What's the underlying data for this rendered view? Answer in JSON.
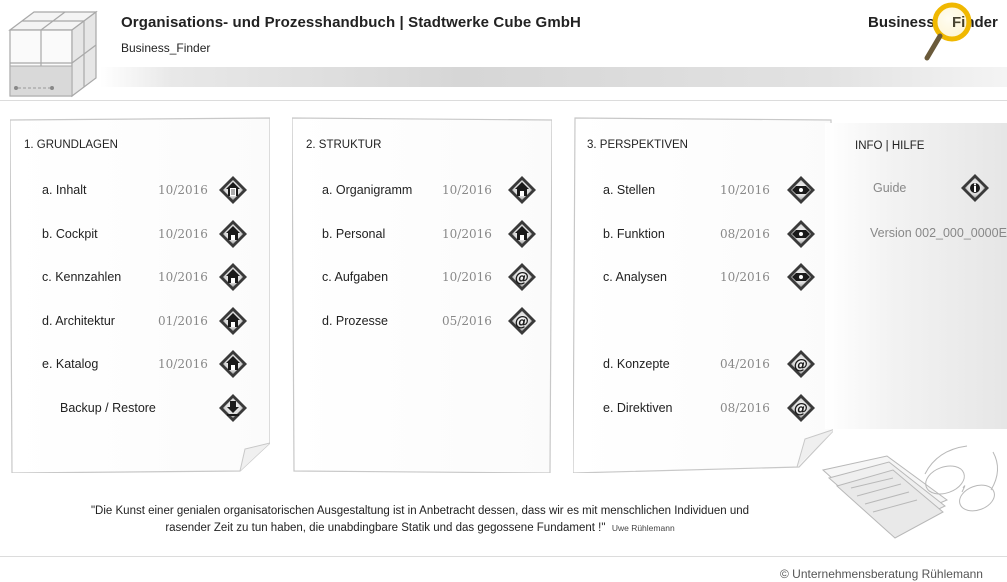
{
  "header": {
    "title": "Organisations- und Prozesshandbuch | Stadtwerke Cube GmbH",
    "subtitle": "Business_Finder",
    "brand_left": "Business",
    "brand_right": "Finder"
  },
  "panels": [
    {
      "title": "1.  GRUNDLAGEN",
      "items": [
        {
          "label": "a.  Inhalt",
          "date": "10/2016",
          "icon": "house-page-icon"
        },
        {
          "label": "b.  Cockpit",
          "date": "10/2016",
          "icon": "house-icon"
        },
        {
          "label": "c.  Kennzahlen",
          "date": "10/2016",
          "icon": "house-icon"
        },
        {
          "label": "d.  Architektur",
          "date": "01/2016",
          "icon": "house-icon"
        },
        {
          "label": "e.  Katalog",
          "date": "10/2016",
          "icon": "house-icon"
        },
        {
          "label": "Backup / Restore",
          "date": "",
          "icon": "download-icon"
        }
      ]
    },
    {
      "title": "2.  STRUKTUR",
      "items": [
        {
          "label": "a.  Organigramm",
          "date": "10/2016",
          "icon": "house-icon"
        },
        {
          "label": "b.  Personal",
          "date": "10/2016",
          "icon": "house-icon"
        },
        {
          "label": "c.  Aufgaben",
          "date": "10/2016",
          "icon": "at-icon"
        },
        {
          "label": "d.  Prozesse",
          "date": "05/2016",
          "icon": "at-icon"
        }
      ]
    },
    {
      "title": "3.  PERSPEKTIVEN",
      "items": [
        {
          "label": "a.  Stellen",
          "date": "10/2016",
          "icon": "arrows-icon"
        },
        {
          "label": "b.  Funktion",
          "date": "08/2016",
          "icon": "arrows-icon"
        },
        {
          "label": "c.  Analysen",
          "date": "10/2016",
          "icon": "arrows-icon"
        },
        {
          "label": "d.  Konzepte",
          "date": "04/2016",
          "icon": "at-icon"
        },
        {
          "label": "e.  Direktiven",
          "date": "08/2016",
          "icon": "at-icon"
        }
      ]
    }
  ],
  "info": {
    "title": "INFO | HILFE",
    "guide": "Guide",
    "version": "Version  002_000_0000E"
  },
  "quote": {
    "line1": "\"Die Kunst einer genialen organisatorischen Ausgestaltung ist in Anbetracht dessen, dass wir es mit menschlichen Individuen und",
    "line2": "rasender  Zeit  zu tun haben, die unabdingbare Statik und das gegossene Fundament !\"",
    "author": "Uwe Rühlemann"
  },
  "footer": {
    "copyright": "© Unternehmensberatung Rühlemann"
  }
}
